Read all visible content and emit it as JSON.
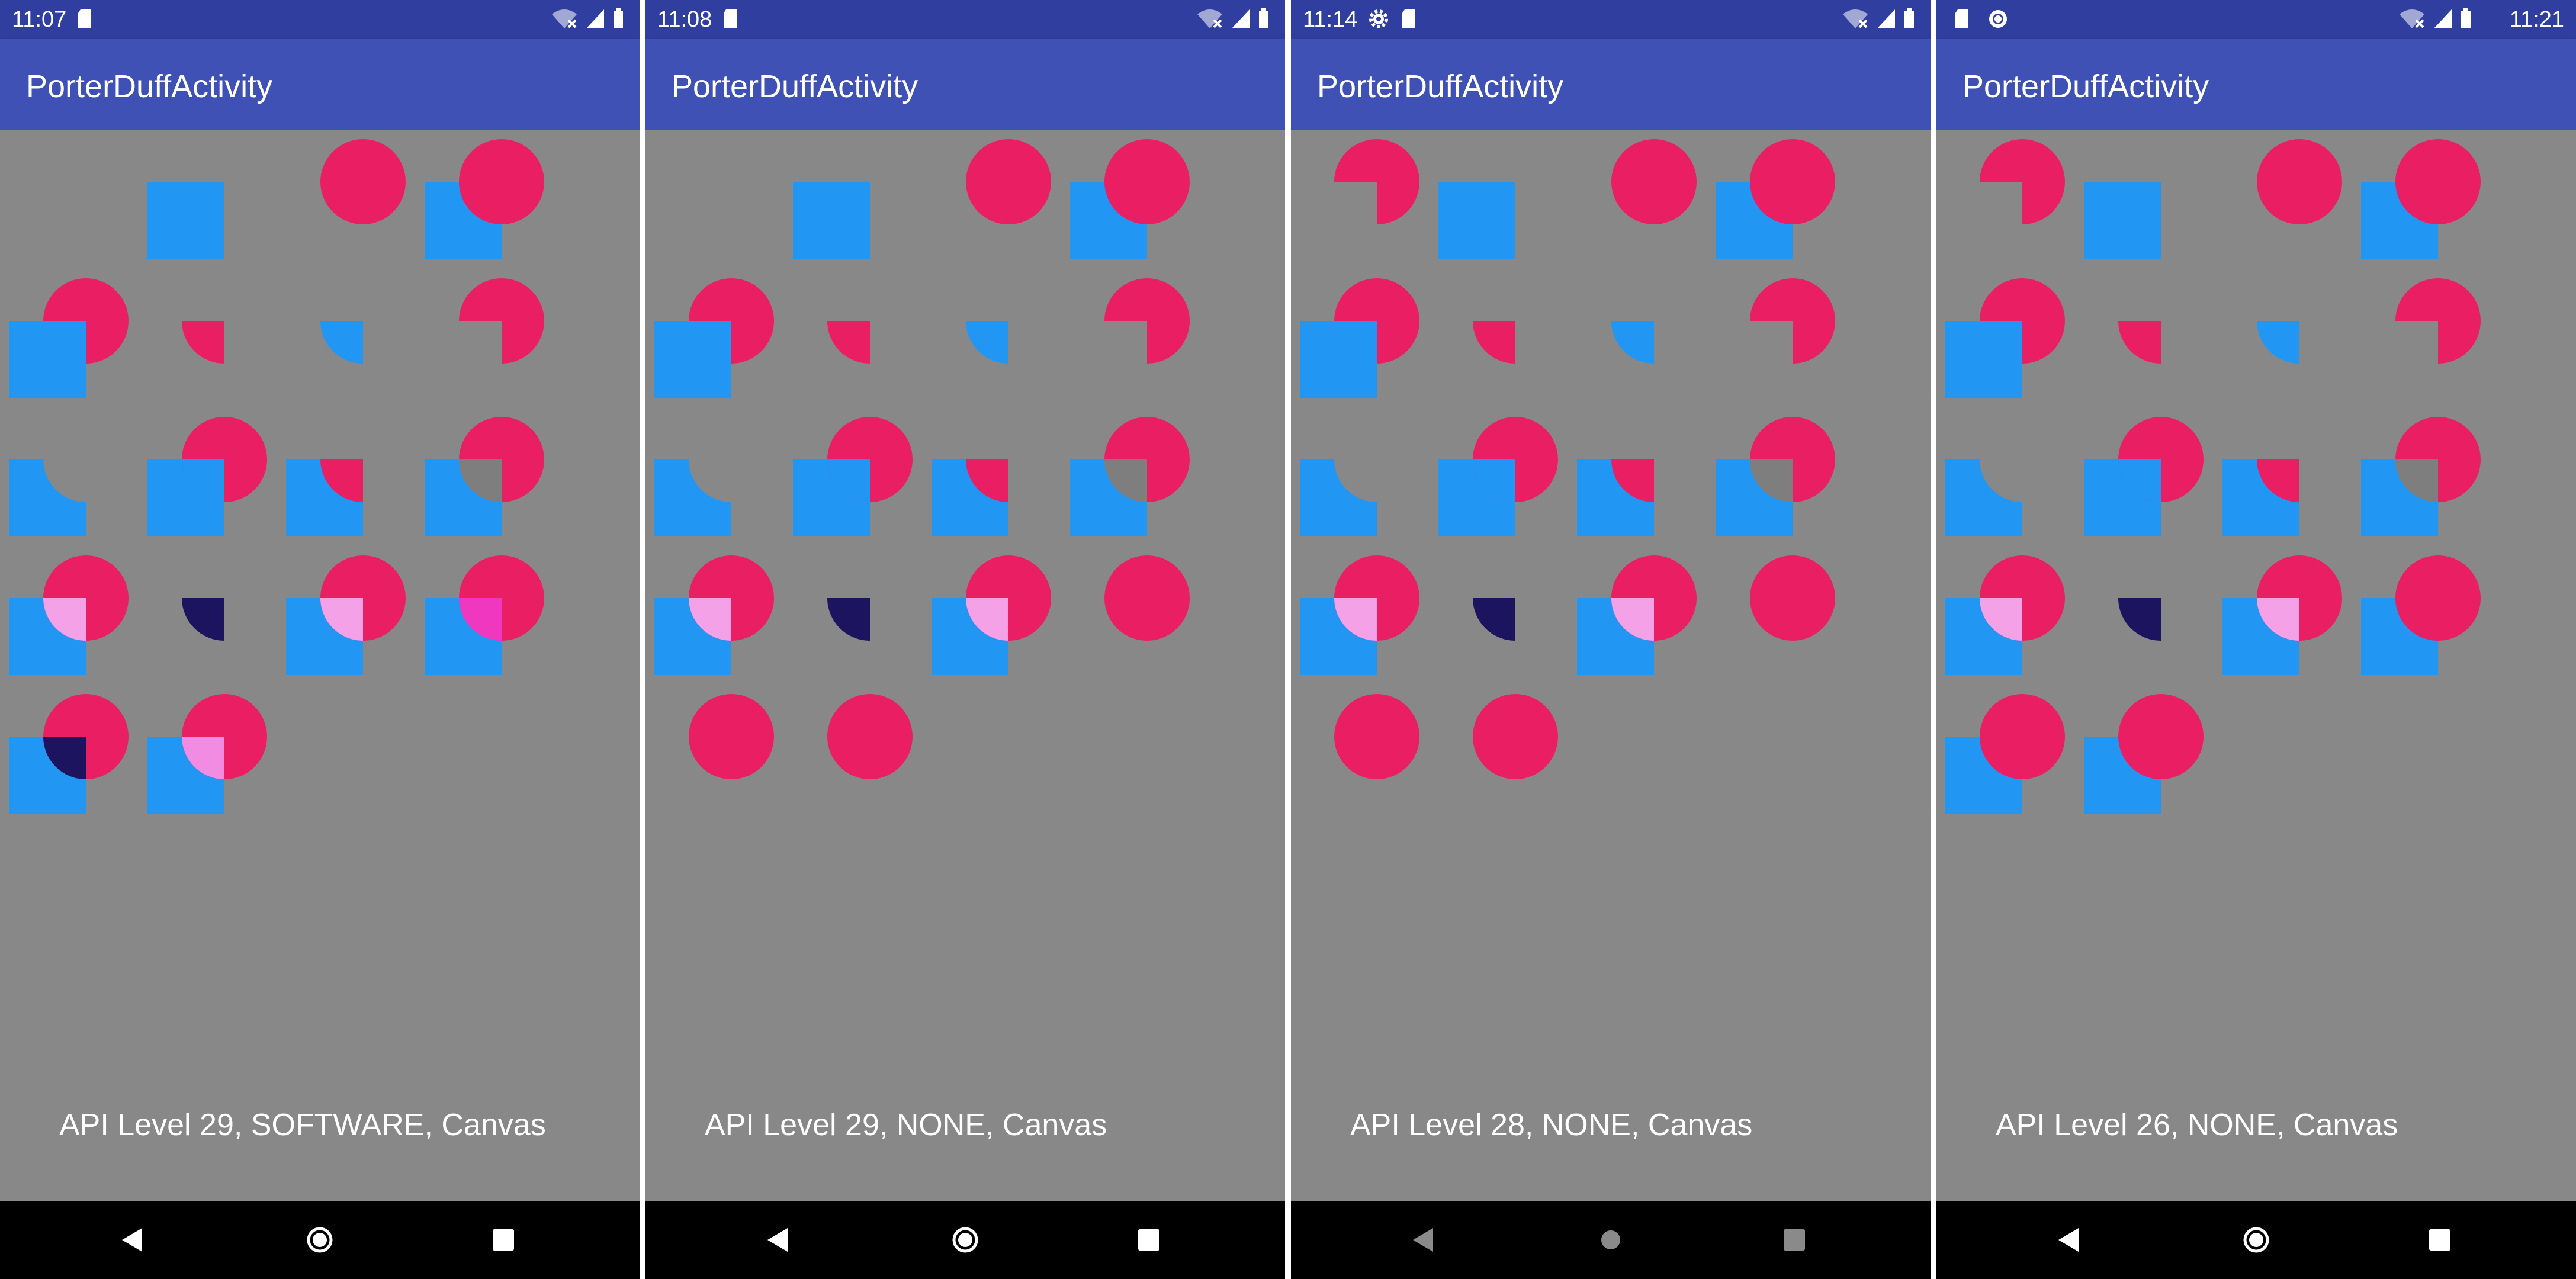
{
  "panels": [
    {
      "time": "11:07",
      "title": "PorterDuffActivity",
      "caption": "API Level 29, SOFTWARE, Canvas",
      "nav_dim": false,
      "status_left_icons": [
        "sd-card-icon"
      ],
      "status_right_icons": [
        "wifi-off-icon",
        "signal-icon",
        "battery-icon"
      ],
      "time_on_right": false,
      "cells": [
        "none",
        "dst",
        "src",
        "src-over",
        "dst-over",
        "src-in",
        "dst-in",
        "src-out",
        "dst-out",
        "src-atop",
        "dst-atop",
        "xor",
        "screen",
        "multiply",
        "lighten",
        "add",
        "darken",
        "overlay"
      ]
    },
    {
      "time": "11:08",
      "title": "PorterDuffActivity",
      "caption": "API Level 29, NONE, Canvas",
      "nav_dim": false,
      "status_left_icons": [
        "sd-card-icon"
      ],
      "status_right_icons": [
        "wifi-off-icon",
        "signal-icon",
        "battery-icon"
      ],
      "time_on_right": false,
      "cells": [
        "none",
        "dst",
        "src",
        "src-over",
        "dst-over",
        "src-in",
        "dst-in",
        "src-out",
        "dst-out",
        "src-atop",
        "dst-atop",
        "xor",
        "screen",
        "multiply",
        "lighten",
        "src-only",
        "src-only",
        "src-only"
      ]
    },
    {
      "time": "11:14",
      "title": "PorterDuffActivity",
      "caption": "API Level 28, NONE, Canvas",
      "nav_dim": true,
      "status_left_icons": [
        "gear-icon",
        "sd-card-icon"
      ],
      "status_right_icons": [
        "wifi-off-icon",
        "signal-icon",
        "battery-icon"
      ],
      "time_on_right": false,
      "cells": [
        "dst-out-plain",
        "dst",
        "src",
        "src-over",
        "dst-over",
        "src-in",
        "dst-in",
        "src-out",
        "dst-out",
        "src-atop",
        "dst-atop",
        "xor",
        "screen",
        "multiply",
        "lighten",
        "src-only",
        "src-only",
        "src-only"
      ]
    },
    {
      "time": "11:21",
      "title": "PorterDuffActivity",
      "caption": "API Level 26, NONE, Canvas",
      "nav_dim": false,
      "status_left_icons": [
        "sd-card-icon",
        "sync-icon"
      ],
      "status_right_icons": [
        "wifi-off-icon",
        "signal-icon",
        "battery-icon"
      ],
      "time_on_right": true,
      "cells": [
        "dst-out-plain",
        "dst",
        "src",
        "src-over",
        "dst-over",
        "src-in",
        "dst-in",
        "src-out",
        "dst-out",
        "src-atop",
        "dst-atop",
        "xor",
        "screen",
        "multiply",
        "lighten",
        "src-over",
        "src-over",
        "src-over"
      ]
    }
  ],
  "colors": {
    "circle": "#e91e63",
    "square": "#2196f3",
    "screen": "#f5a1e8",
    "multiply": "#1c145f",
    "xor_overlap": "#7e7e7e",
    "add": "#f037c0",
    "darken": "#1c145f",
    "overlay": "#f28ce2"
  }
}
